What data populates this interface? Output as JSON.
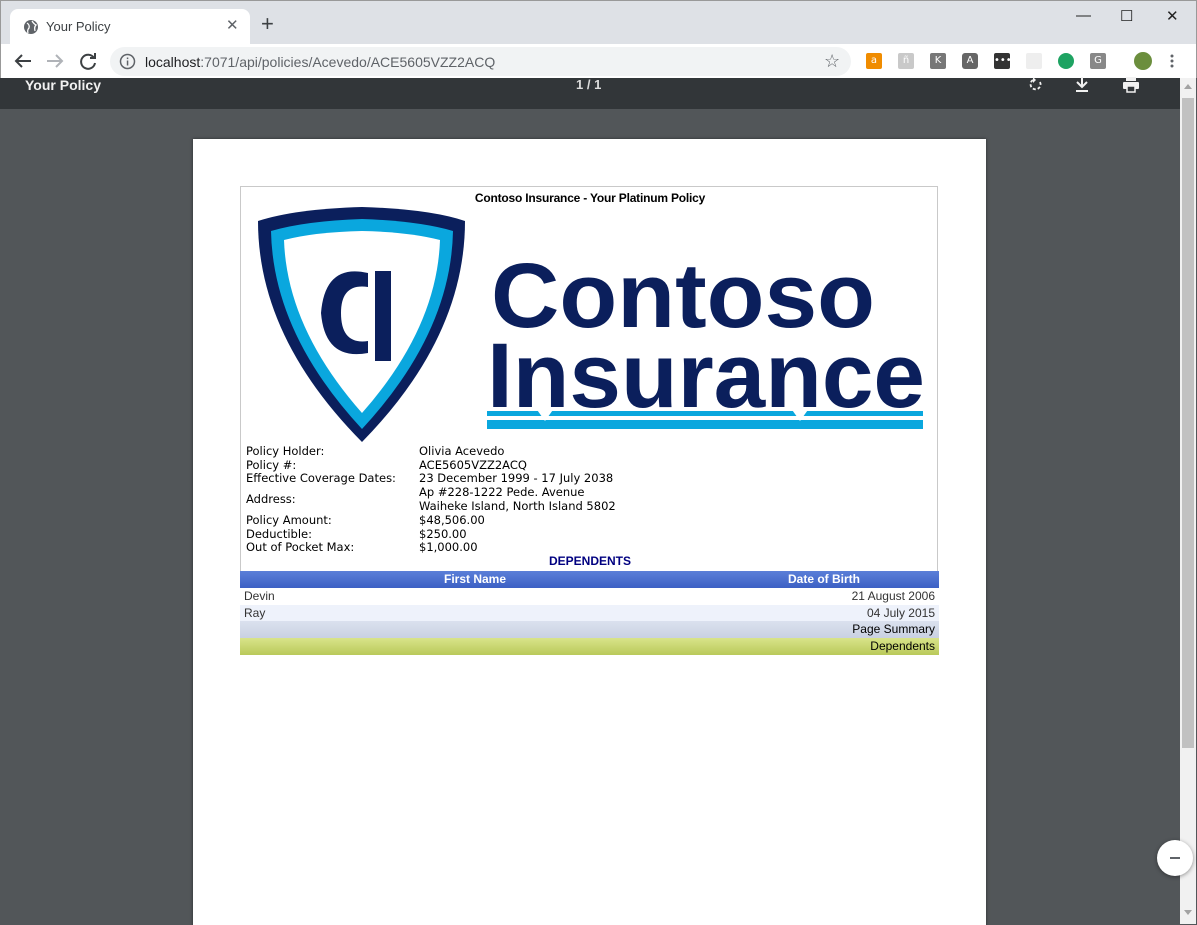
{
  "browser": {
    "tab_title": "Your Policy",
    "tab_close": "✕",
    "new_tab": "+",
    "url_host": "localhost",
    "url_rest": ":7071/api/policies/Acevedo/ACE5605VZZ2ACQ",
    "star": "☆",
    "window_controls": {
      "minimize": "—",
      "maximize": "☐",
      "close": "✕"
    }
  },
  "pdf_viewer": {
    "title": "Your Policy",
    "page_count": "1 / 1"
  },
  "report": {
    "title": "Contoso Insurance - Your Platinum Policy",
    "logo": {
      "monogram": "CI",
      "line1": "Contoso",
      "line2": "Insurance",
      "colors": {
        "navy": "#0b1f5c",
        "cyan": "#0aa7de"
      }
    },
    "fields": [
      {
        "label": "Policy Holder:",
        "value": "Olivia Acevedo"
      },
      {
        "label": "Policy #:",
        "value": "ACE5605VZZ2ACQ"
      },
      {
        "label": "Effective Coverage Dates:",
        "value": "23 December 1999 - 17 July 2038"
      },
      {
        "label": "Address:",
        "value": "Ap #228-1222 Pede. Avenue",
        "value2": "Waiheke Island, North Island 5802"
      },
      {
        "label": "Policy Amount:",
        "value": "$48,506.00"
      },
      {
        "label": "Deductible:",
        "value": "$250.00"
      },
      {
        "label": "Out of Pocket Max:",
        "value": "$1,000.00"
      }
    ],
    "dependents_heading": "DEPENDENTS",
    "dependents_columns": {
      "first_name": "First Name",
      "dob": "Date of Birth"
    },
    "dependents": [
      {
        "first_name": "Devin",
        "dob": "21 August 2006"
      },
      {
        "first_name": "Ray",
        "dob": "04 July 2015"
      }
    ],
    "page_summary": "Page Summary",
    "dependents_footer": "Dependents"
  }
}
